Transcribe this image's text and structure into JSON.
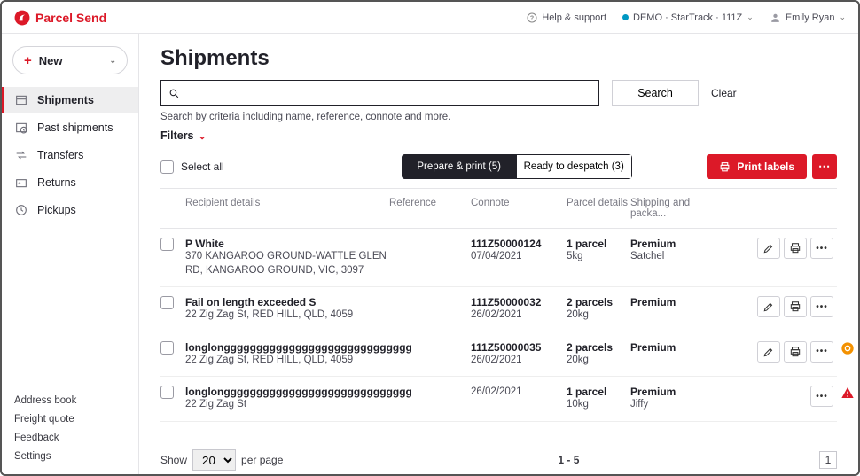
{
  "brand": {
    "name": "Parcel Send"
  },
  "header": {
    "help": "Help & support",
    "account": "DEMO · StarTrack · 111Z",
    "user": "Emily Ryan"
  },
  "new_button": {
    "label": "New"
  },
  "sidebar": {
    "items": [
      {
        "label": "Shipments",
        "active": true
      },
      {
        "label": "Past shipments"
      },
      {
        "label": "Transfers"
      },
      {
        "label": "Returns"
      },
      {
        "label": "Pickups"
      }
    ],
    "footer": [
      "Address book",
      "Freight quote",
      "Feedback",
      "Settings"
    ]
  },
  "page": {
    "title": "Shipments",
    "search_placeholder": "",
    "search_button": "Search",
    "clear": "Clear",
    "hint_prefix": "Search by criteria including name, reference, connote and ",
    "hint_more": "more.",
    "filters_label": "Filters"
  },
  "toolbar": {
    "select_all": "Select all",
    "tab1": "Prepare & print (5)",
    "tab2": "Ready to despatch (3)",
    "print": "Print labels"
  },
  "columns": {
    "recipient": "Recipient details",
    "reference": "Reference",
    "connote": "Connote",
    "parcel": "Parcel details",
    "shipping": "Shipping and packa..."
  },
  "rows": [
    {
      "name": "P White",
      "addr": "370 KANGAROO GROUND-WATTLE GLEN RD, KANGAROO GROUND, VIC, 3097",
      "connote": "111Z50000124",
      "date": "07/04/2021",
      "parcels": "1 parcel",
      "weight": "5kg",
      "shipping": "Premium",
      "packaging": "Satchel",
      "actions": [
        "edit",
        "print",
        "more"
      ],
      "status": null
    },
    {
      "name": "Fail on length exceeded S",
      "addr": "22 Zig Zag St, RED HILL, QLD, 4059",
      "connote": "111Z50000032",
      "date": "26/02/2021",
      "parcels": "2 parcels",
      "weight": "20kg",
      "shipping": "Premium",
      "packaging": "",
      "actions": [
        "edit",
        "print",
        "more"
      ],
      "status": null
    },
    {
      "name": "longlonggggggggggggggggggggggggggggg",
      "addr": "22 Zig Zag St, RED HILL, QLD, 4059",
      "connote": "111Z50000035",
      "date": "26/02/2021",
      "parcels": "2 parcels",
      "weight": "20kg",
      "shipping": "Premium",
      "packaging": "",
      "actions": [
        "edit",
        "print",
        "more"
      ],
      "status": "processing"
    },
    {
      "name": "longlonggggggggggggggggggggggggggggg",
      "addr": "22 Zig Zag St",
      "connote": "",
      "date": "26/02/2021",
      "parcels": "1 parcel",
      "weight": "10kg",
      "shipping": "Premium",
      "packaging": "Jiffy",
      "actions": [
        "more"
      ],
      "status": "error"
    }
  ],
  "pager": {
    "show_label": "Show",
    "per_page": "20",
    "per_page_suffix": "per page",
    "range": "1 - 5",
    "page": "1"
  }
}
